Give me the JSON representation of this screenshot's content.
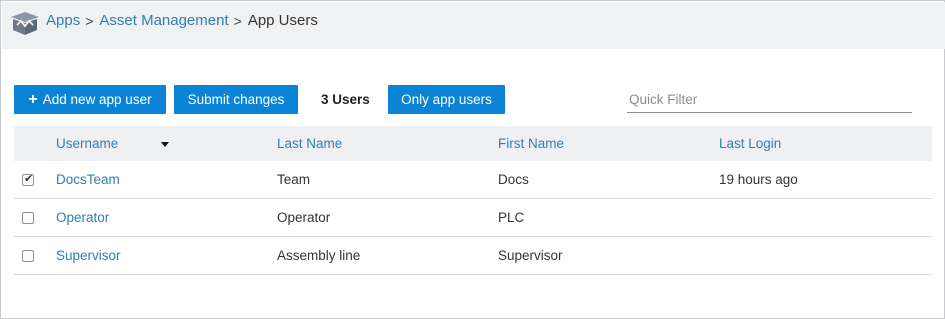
{
  "breadcrumb": {
    "items": [
      {
        "label": "Apps"
      },
      {
        "label": "Asset Management"
      },
      {
        "label": "App Users"
      }
    ],
    "separator": ">"
  },
  "toolbar": {
    "add_icon": "+",
    "add_label": "Add new app user",
    "submit_label": "Submit changes",
    "user_count": "3 Users",
    "only_label": "Only app users",
    "filter_placeholder": "Quick Filter",
    "filter_value": ""
  },
  "table": {
    "columns": [
      "Username",
      "Last Name",
      "First Name",
      "Last Login"
    ],
    "sorted_column": "Username",
    "rows": [
      {
        "checked": true,
        "username": "DocsTeam",
        "last_name": "Team",
        "first_name": "Docs",
        "last_login": "19 hours ago"
      },
      {
        "checked": false,
        "username": "Operator",
        "last_name": "Operator",
        "first_name": "PLC",
        "last_login": ""
      },
      {
        "checked": false,
        "username": "Supervisor",
        "last_name": "Assembly line",
        "first_name": "Supervisor",
        "last_login": ""
      }
    ]
  },
  "colors": {
    "accent": "#0c84d6",
    "link": "#2f7fb2",
    "header_bg": "#f0f1f3"
  },
  "icons": {
    "app": "open-box-icon",
    "sort": "sort-descending-icon",
    "check": "checkmark-icon"
  }
}
